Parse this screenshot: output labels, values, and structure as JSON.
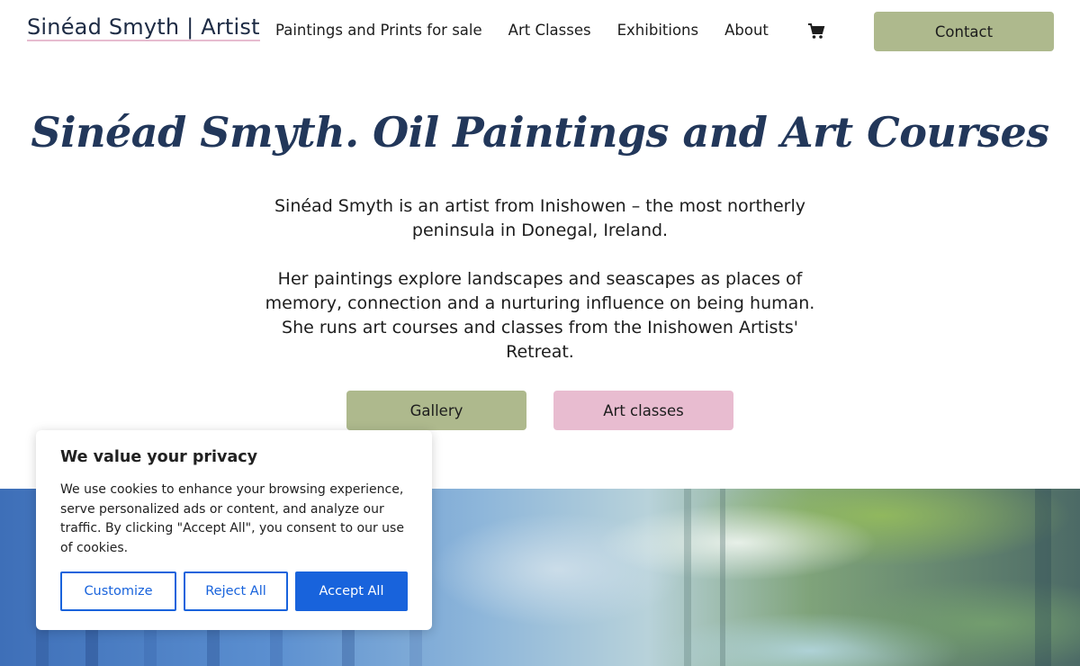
{
  "header": {
    "site_title": "Sinéad Smyth | Artist",
    "nav": [
      {
        "label": "Paintings and Prints for sale"
      },
      {
        "label": "Art Classes"
      },
      {
        "label": "Exhibitions"
      },
      {
        "label": "About"
      }
    ],
    "cart_icon": "shopping-cart-icon",
    "contact_label": "Contact"
  },
  "hero": {
    "title": "Sinéad Smyth. Oil Paintings and Art Courses",
    "paragraph_1": "Sinéad Smyth is an artist from Inishowen – the most northerly peninsula in Donegal, Ireland.",
    "paragraph_2": "Her paintings explore landscapes and seascapes as places of memory, connection and a nurturing influence on being human. She runs art courses and classes from the Inishowen Artists' Retreat.",
    "gallery_label": "Gallery",
    "classes_label": "Art classes"
  },
  "cookie_banner": {
    "title": "We value your privacy",
    "text": "We use cookies to enhance your browsing experience, serve personalized ads or content, and analyze our traffic. By clicking \"Accept All\", you consent to our use of cookies.",
    "customize_label": "Customize",
    "reject_label": "Reject All",
    "accept_label": "Accept All"
  },
  "colors": {
    "title_navy": "#22375a",
    "sage_button": "#aeb98d",
    "pink_button": "#e8bcd0",
    "cookie_blue": "#1863dc"
  }
}
